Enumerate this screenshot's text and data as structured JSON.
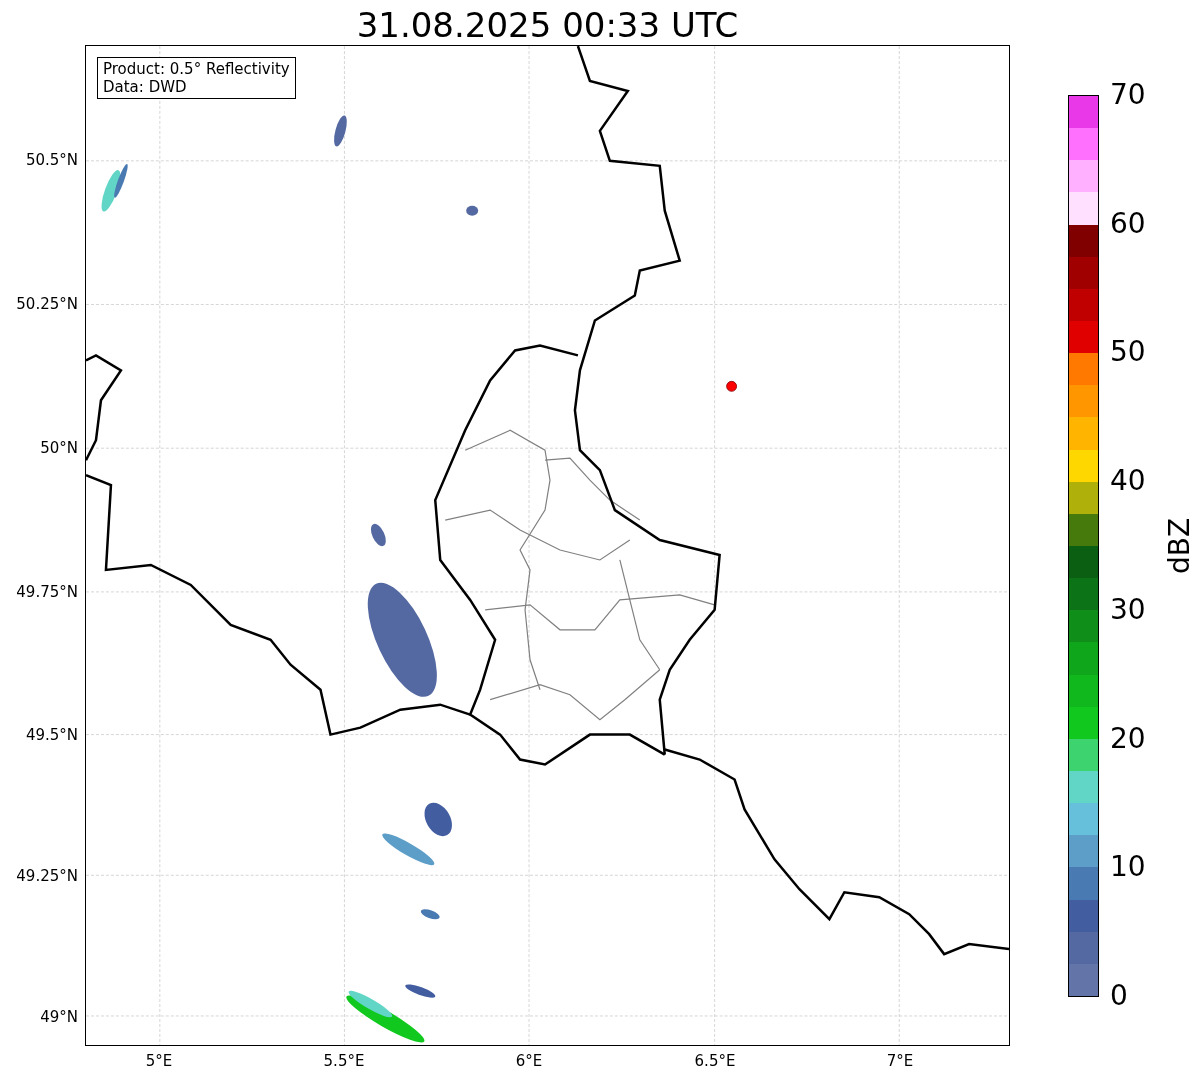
{
  "title": "31.08.2025 00:33 UTC",
  "info_box": {
    "lines": [
      "Product: 0.5° Reflectivity",
      "Data: DWD"
    ]
  },
  "map": {
    "lat_ticks": [
      "50.5°N",
      "50.25°N",
      "50°N",
      "49.75°N",
      "49.5°N",
      "49.25°N",
      "49°N"
    ],
    "lon_ticks": [
      "5°E",
      "5.5°E",
      "6°E",
      "6.5°E",
      "7°E"
    ]
  },
  "colorbar": {
    "label": "dBZ",
    "ticks": [
      "70",
      "60",
      "50",
      "40",
      "30",
      "20",
      "10",
      "0"
    ],
    "bands": [
      {
        "color": "#e838e8"
      },
      {
        "color": "#ff70ff"
      },
      {
        "color": "#ffb0ff"
      },
      {
        "color": "#ffe0ff"
      },
      {
        "color": "#800000"
      },
      {
        "color": "#a00000"
      },
      {
        "color": "#c00000"
      },
      {
        "color": "#e00000"
      },
      {
        "color": "#ff7800"
      },
      {
        "color": "#ff9600"
      },
      {
        "color": "#ffb400"
      },
      {
        "color": "#ffd700"
      },
      {
        "color": "#b0b00a"
      },
      {
        "color": "#477a0c"
      },
      {
        "color": "#0b5f12"
      },
      {
        "color": "#0c7417"
      },
      {
        "color": "#0f8e1a"
      },
      {
        "color": "#0fa61b"
      },
      {
        "color": "#10b81e"
      },
      {
        "color": "#10c81e"
      },
      {
        "color": "#3dd470"
      },
      {
        "color": "#62d6c6"
      },
      {
        "color": "#66c0dc"
      },
      {
        "color": "#5c9ec8"
      },
      {
        "color": "#4a7ab2"
      },
      {
        "color": "#435ea0"
      },
      {
        "color": "#5469a2"
      },
      {
        "color": "#6374a8"
      }
    ]
  }
}
